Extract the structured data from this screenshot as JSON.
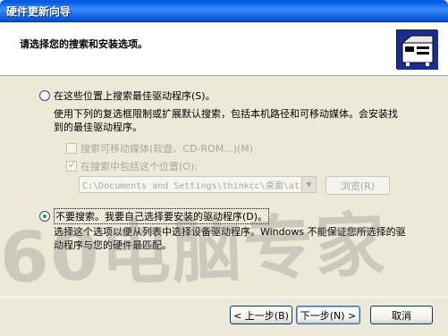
{
  "window": {
    "title": "硬件更新向导"
  },
  "header": {
    "title": "请选择您的搜索和安装选项。",
    "icon": "hardware-wizard-icon"
  },
  "option_search": {
    "label": "在这些位置上搜索最佳驱动程序(S)。",
    "desc1": "使用下列的复选框限制或扩展默认搜索，包括本机路径和可移动媒体。会安装找",
    "desc2": "到的最佳驱动程序。",
    "checked": false
  },
  "check_removable": {
    "label": "搜索可移动媒体(软盘、CD-ROM...)(M)",
    "checked": false
  },
  "check_location": {
    "label": "在搜索中包括这个位置(O):",
    "checked": true
  },
  "path": {
    "value": "C:\\Documents and Settings\\thinkcc\\桌面\\ati"
  },
  "browse_label": "浏览(R)",
  "option_manual": {
    "label": "不要搜索。我要自己选择要安装的驱动程序(D)。",
    "desc1": "选择这个选项以便从列表中选择设备驱动程序。Windows 不能保证您所选择的驱",
    "desc2": "动程序与您的硬件最匹配。",
    "checked": true
  },
  "buttons": {
    "back": "< 上一步(B)",
    "next": "下一步(N) >",
    "cancel": "取消"
  },
  "watermark": "60电脑专家"
}
